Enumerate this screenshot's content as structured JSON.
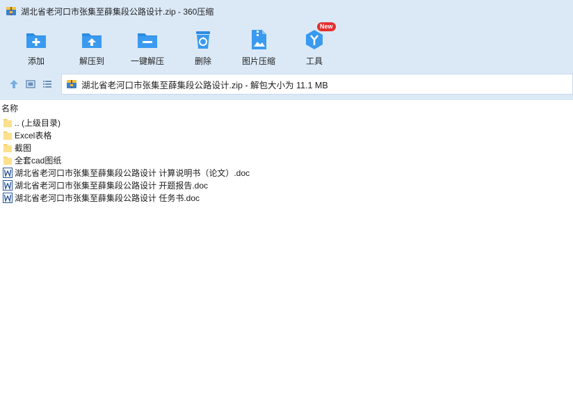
{
  "window": {
    "title": "湖北省老河口市张集至薛集段公路设计.zip - 360压缩"
  },
  "toolbar": {
    "add_label": "添加",
    "extract_to_label": "解压到",
    "one_click_extract_label": "一键解压",
    "delete_label": "删除",
    "image_compress_label": "图片压缩",
    "tools_label": "工具",
    "tools_badge": "New"
  },
  "address": {
    "path": "湖北省老河口市张集至薛集段公路设计.zip - 解包大小为 11.1 MB"
  },
  "list": {
    "column_name": "名称",
    "items": [
      {
        "name": ".. (上级目录)",
        "type": "folder"
      },
      {
        "name": "Excel表格",
        "type": "folder"
      },
      {
        "name": "截图",
        "type": "folder"
      },
      {
        "name": "全套cad图纸",
        "type": "folder"
      },
      {
        "name": "湖北省老河口市张集至薛集段公路设计 计算说明书（论文）.doc",
        "type": "doc"
      },
      {
        "name": "湖北省老河口市张集至薛集段公路设计 开题报告.doc",
        "type": "doc"
      },
      {
        "name": "湖北省老河口市张集至薛集段公路设计 任务书.doc",
        "type": "doc"
      }
    ]
  },
  "colors": {
    "accent": "#2b8ce0",
    "chrome_bg": "#dbe9f7",
    "folder": "#f7d26b",
    "badge": "#e4312f"
  }
}
